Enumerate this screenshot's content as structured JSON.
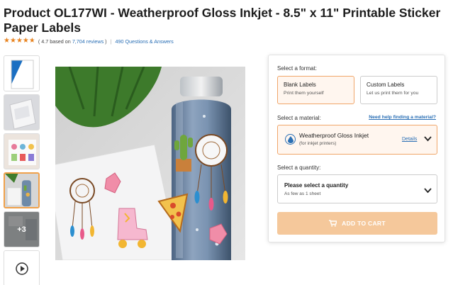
{
  "product": {
    "title": "Product OL177WI - Weatherproof Gloss Inkjet - 8.5\" x 11\" Printable Sticker Paper Labels",
    "rating_prefix": "( 4.7 based on",
    "reviews": "7,704 reviews",
    "rating_suffix": ")",
    "questions": "490 Questions & Answers",
    "stars": 4.7,
    "divider": "|"
  },
  "gallery": {
    "more_count": "+3",
    "active_index": 3
  },
  "purchase": {
    "format_label": "Select a format:",
    "formats": [
      {
        "title": "Blank Labels",
        "subtitle": "Print them yourself",
        "selected": true
      },
      {
        "title": "Custom Labels",
        "subtitle": "Let us print them for you",
        "selected": false
      }
    ],
    "material_label": "Select a material:",
    "material_help": "Need help finding a material?",
    "material_name": "Weatherproof Gloss Inkjet",
    "material_sub": "(for inkjet printers)",
    "material_details": "Details",
    "quantity_label": "Select a quantity:",
    "quantity_title": "Please select a quantity",
    "quantity_sub": "As few as 1 sheet",
    "cart_label": "ADD TO CART"
  },
  "colors": {
    "accent": "#f0a66a",
    "link": "#2a6fb5",
    "star": "#e8831f",
    "cart": "#f5c89b"
  },
  "icons": [
    "star-icon",
    "ink-drop-icon",
    "chevron-down-icon",
    "cart-icon",
    "play-icon"
  ]
}
